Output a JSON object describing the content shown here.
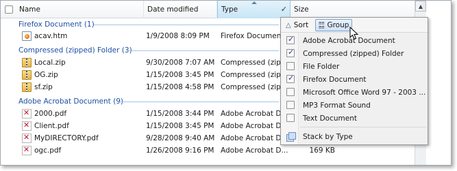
{
  "columns": {
    "name": "Name",
    "date_modified": "Date modified",
    "type": "Type",
    "size": "Size"
  },
  "groups": [
    {
      "label": "Firefox Document (1)"
    },
    {
      "label": "Compressed (zipped) Folder (3)"
    },
    {
      "label": "Adobe Acrobat Document (9)"
    }
  ],
  "files": [
    {
      "name": "acav.htm",
      "date": "1/9/2008 8:09 PM",
      "type": "Firefox Document",
      "size": "",
      "icon": "htm-file-icon"
    },
    {
      "name": "Local.zip",
      "date": "9/30/2008 7:07 AM",
      "type": "Compressed (zipp...",
      "size": "",
      "icon": "zip-folder-icon"
    },
    {
      "name": "OG.zip",
      "date": "1/15/2008 3:45 PM",
      "type": "Compressed (zipp...",
      "size": "",
      "icon": "zip-folder-icon"
    },
    {
      "name": "sf.zip",
      "date": "1/15/2008 4:58 PM",
      "type": "Compressed (zipp...",
      "size": "",
      "icon": "zip-folder-icon"
    },
    {
      "name": "2000.pdf",
      "date": "1/15/2008 3:44 PM",
      "type": "Adobe Acrobat D...",
      "size": "",
      "icon": "pdf-file-icon"
    },
    {
      "name": "Client.pdf",
      "date": "1/15/2008 3:45 PM",
      "type": "Adobe Acrobat D...",
      "size": "",
      "icon": "pdf-file-icon"
    },
    {
      "name": "MyDIRECTORY.pdf",
      "date": "9/28/2008 9:40 AM",
      "type": "Adobe Acrobat D...",
      "size": "",
      "icon": "pdf-file-icon"
    },
    {
      "name": "ogc.pdf",
      "date": "1/26/2008 9:16 PM",
      "type": "Adobe Acrobat D...",
      "size": "169 KB",
      "icon": "pdf-file-icon"
    }
  ],
  "menu": {
    "sort_label": "Sort",
    "group_label": "Group",
    "items": [
      {
        "label": "Adobe Acrobat Document",
        "checked": true
      },
      {
        "label": "Compressed (zipped) Folder",
        "checked": true
      },
      {
        "label": "File Folder",
        "checked": false
      },
      {
        "label": "Firefox Document",
        "checked": true
      },
      {
        "label": "Microsoft Office Word 97 - 2003 ...",
        "checked": false
      },
      {
        "label": "MP3 Format Sound",
        "checked": false
      },
      {
        "label": "Text Document",
        "checked": false
      }
    ],
    "stack_label": "Stack by Type"
  },
  "colors": {
    "group_text": "#1e4fa3",
    "header_active": "#c7e5f6",
    "menu_bg": "#f0f0f0"
  }
}
